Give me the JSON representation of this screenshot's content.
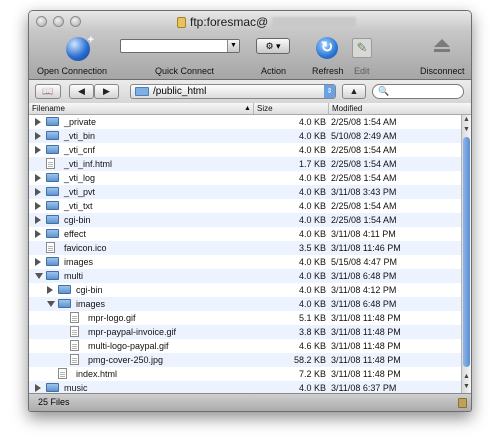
{
  "window": {
    "title": "ftp:foresmac@"
  },
  "toolbar": {
    "open_connection": "Open Connection",
    "quick_connect": "Quick Connect",
    "action": "Action",
    "refresh": "Refresh",
    "edit": "Edit",
    "disconnect": "Disconnect"
  },
  "navbar": {
    "back": "◀",
    "forward": "▶",
    "path": "/public_html",
    "up": "▲",
    "search_value": ""
  },
  "columns": {
    "filename": "Filename",
    "size": "Size",
    "modified": "Modified"
  },
  "files": [
    {
      "name": "_private",
      "size": "4.0 KB",
      "modified": "2/25/08 1:54 AM",
      "type": "folder",
      "depth": 0,
      "expanded": false
    },
    {
      "name": "_vti_bin",
      "size": "4.0 KB",
      "modified": "5/10/08 2:49 AM",
      "type": "folder",
      "depth": 0,
      "expanded": false
    },
    {
      "name": "_vti_cnf",
      "size": "4.0 KB",
      "modified": "2/25/08 1:54 AM",
      "type": "folder",
      "depth": 0,
      "expanded": false
    },
    {
      "name": "_vti_inf.html",
      "size": "1.7 KB",
      "modified": "2/25/08 1:54 AM",
      "type": "file",
      "depth": 0
    },
    {
      "name": "_vti_log",
      "size": "4.0 KB",
      "modified": "2/25/08 1:54 AM",
      "type": "folder",
      "depth": 0,
      "expanded": false
    },
    {
      "name": "_vti_pvt",
      "size": "4.0 KB",
      "modified": "3/11/08 3:43 PM",
      "type": "folder",
      "depth": 0,
      "expanded": false
    },
    {
      "name": "_vti_txt",
      "size": "4.0 KB",
      "modified": "2/25/08 1:54 AM",
      "type": "folder",
      "depth": 0,
      "expanded": false
    },
    {
      "name": "cgi-bin",
      "size": "4.0 KB",
      "modified": "2/25/08 1:54 AM",
      "type": "folder",
      "depth": 0,
      "expanded": false
    },
    {
      "name": "effect",
      "size": "4.0 KB",
      "modified": "3/11/08 4:11 PM",
      "type": "folder",
      "depth": 0,
      "expanded": false
    },
    {
      "name": "favicon.ico",
      "size": "3.5 KB",
      "modified": "3/11/08 11:46 PM",
      "type": "file",
      "depth": 0
    },
    {
      "name": "images",
      "size": "4.0 KB",
      "modified": "5/15/08 4:47 PM",
      "type": "folder",
      "depth": 0,
      "expanded": false
    },
    {
      "name": "multi",
      "size": "4.0 KB",
      "modified": "3/11/08 6:48 PM",
      "type": "folder",
      "depth": 0,
      "expanded": true
    },
    {
      "name": "cgi-bin",
      "size": "4.0 KB",
      "modified": "3/11/08 4:12 PM",
      "type": "folder",
      "depth": 1,
      "expanded": false
    },
    {
      "name": "images",
      "size": "4.0 KB",
      "modified": "3/11/08 6:48 PM",
      "type": "folder",
      "depth": 1,
      "expanded": true
    },
    {
      "name": "mpr-logo.gif",
      "size": "5.1 KB",
      "modified": "3/11/08 11:48 PM",
      "type": "file",
      "depth": 2
    },
    {
      "name": "mpr-paypal-invoice.gif",
      "size": "3.8 KB",
      "modified": "3/11/08 11:48 PM",
      "type": "file",
      "depth": 2
    },
    {
      "name": "multi-logo-paypal.gif",
      "size": "4.6 KB",
      "modified": "3/11/08 11:48 PM",
      "type": "file",
      "depth": 2
    },
    {
      "name": "pmg-cover-250.jpg",
      "size": "58.2 KB",
      "modified": "3/11/08 11:48 PM",
      "type": "file",
      "depth": 2
    },
    {
      "name": "index.html",
      "size": "7.2 KB",
      "modified": "3/11/08 11:48 PM",
      "type": "file",
      "depth": 1
    },
    {
      "name": "music",
      "size": "4.0 KB",
      "modified": "3/11/08 6:37 PM",
      "type": "folder",
      "depth": 0,
      "expanded": false
    }
  ],
  "status": {
    "count": "25 Files"
  },
  "colors": {
    "row_alt": "#edf3fe",
    "folder": "#5f93cf",
    "accent": "#6aa0e4"
  }
}
